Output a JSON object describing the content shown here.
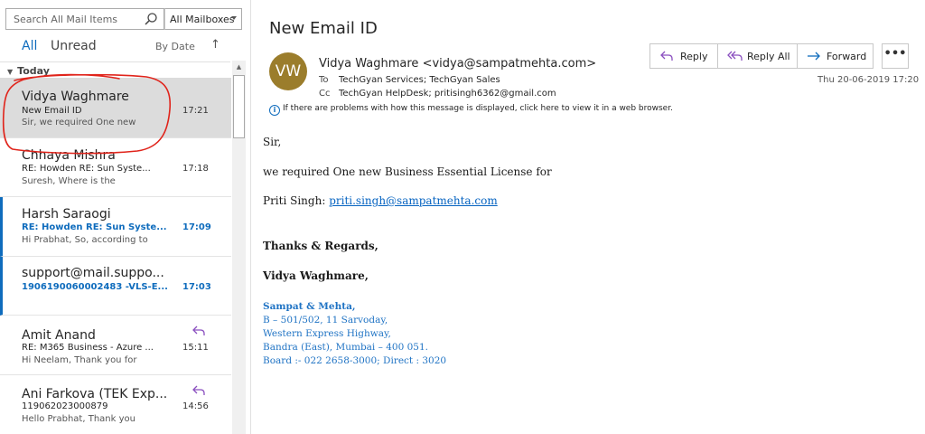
{
  "search": {
    "placeholder": "Search All Mail Items",
    "mailbox": "All Mailboxes"
  },
  "filters": {
    "all": "All",
    "unread": "Unread",
    "sort": "By Date",
    "sort_arrow": "↑"
  },
  "group": {
    "label": "Today"
  },
  "mails": [
    {
      "sender": "Vidya Waghmare",
      "subject": "New Email ID",
      "preview": "Sir,  we required One new",
      "time": "17:21"
    },
    {
      "sender": "Chhaya Mishra",
      "subject": "RE: Howden RE: Sun Syste...",
      "preview": "Suresh,  Where is the",
      "time": "17:18"
    },
    {
      "sender": "Harsh Saraogi",
      "subject": "RE: Howden RE: Sun Syste...",
      "preview": "Hi Prabhat,  So, according to",
      "time": "17:09"
    },
    {
      "sender": "support@mail.suppo...",
      "subject": "1906190060002483 -VLS-E...",
      "time": "17:03"
    },
    {
      "sender": "Amit Anand",
      "subject": "RE: M365 Business - Azure ...",
      "preview": "Hi Neelam,  Thank you for",
      "time": "15:11"
    },
    {
      "sender": "Ani Farkova (TEK Exp...",
      "subject": "119062023000879",
      "preview": "Hello Prabhat,  Thank you",
      "time": "14:56"
    }
  ],
  "message": {
    "subject": "New Email ID",
    "avatar_initials": "VW",
    "from": "Vidya Waghmare <vidya@sampatmehta.com>",
    "to_label": "To",
    "to": "TechGyan Services; TechGyan Sales",
    "cc_label": "Cc",
    "cc": "TechGyan HelpDesk; pritisingh6362@gmail.com",
    "date": "Thu 20-06-2019 17:20",
    "info": "If there are problems with how this message is displayed, click here to view it in a web browser."
  },
  "actions": {
    "reply": "Reply",
    "reply_all": "Reply All",
    "forward": "Forward",
    "more": "•••"
  },
  "body": {
    "greeting": "Sir,",
    "line1": "we required One new  Business Essential License for",
    "name_label": "Priti Singh: ",
    "email_link": "priti.singh@sampatmehta.com",
    "thanks": "Thanks & Regards,",
    "signer": "Vidya Waghmare,",
    "company": "Sampat & Mehta,",
    "address1": "B – 501/502, 11 Sarvoday,",
    "address2": "Western Express Highway,",
    "address3": "Bandra (East), Mumbai – 400 051.",
    "phone": "Board :- 022 2658-3000; Direct : 3020"
  },
  "colors": {
    "accent": "#0f6cbd",
    "avatar": "#9b7d2c",
    "selected": "#dcdcdc",
    "annotation": "#e0241b"
  },
  "icons": [
    "search-icon",
    "chevron-down-icon",
    "reply-icon",
    "reply-all-icon",
    "forward-icon",
    "info-icon",
    "replied-icon"
  ]
}
